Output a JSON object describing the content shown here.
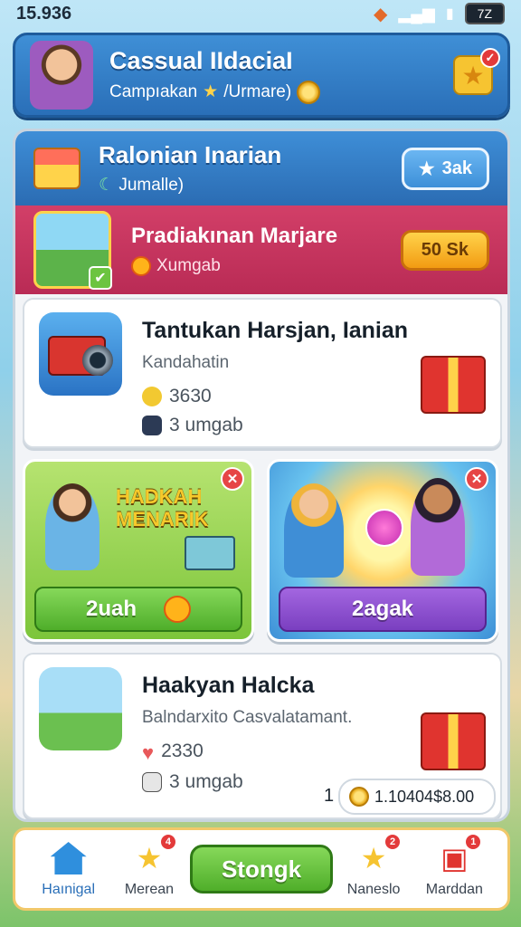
{
  "status": {
    "time": "15.936",
    "battery": "7Z"
  },
  "header": {
    "title": "Cassual IIdaciaI",
    "subtitle_prefix": "Campıakan",
    "subtitle_rest": "/Urmare)"
  },
  "panel": {
    "title": "Ralonian Inarian",
    "subtitle": "Jumalle)",
    "button_label": "3ak"
  },
  "promo": {
    "title": "Pradiakınan Marjare",
    "subtitle": "Xumgab",
    "button_label": "50 Sk"
  },
  "tasks": [
    {
      "title": "Tantukan Harsjan, Ianian",
      "subtitle": "Kandahatin",
      "value": "3630",
      "duration": "3 umgab"
    },
    {
      "title": "Haakyan Halcka",
      "subtitle": "Balndarxito Casvalatamant.",
      "value": "2330",
      "duration": "3 umgab"
    }
  ],
  "tiles": [
    {
      "label_line1": "HADKAH",
      "label_line2": "MENARIK",
      "button_label": "2uah"
    },
    {
      "button_label": "2agak"
    }
  ],
  "balance": {
    "prefix": "1",
    "amount": "1.10404$8.00"
  },
  "nav": {
    "home": "Haınigal",
    "rewards": "Merean",
    "center": "Stongk",
    "favorites": "Naneslo",
    "inbox": "Marddan",
    "badges": {
      "rewards": "4",
      "favorites": "2",
      "inbox": "1"
    }
  },
  "colors": {
    "primary_blue": "#2a6fb8",
    "promo_red": "#b92b55",
    "accent_green": "#4fae2a",
    "accent_purple": "#7a3fc0",
    "gold": "#f6c431"
  }
}
